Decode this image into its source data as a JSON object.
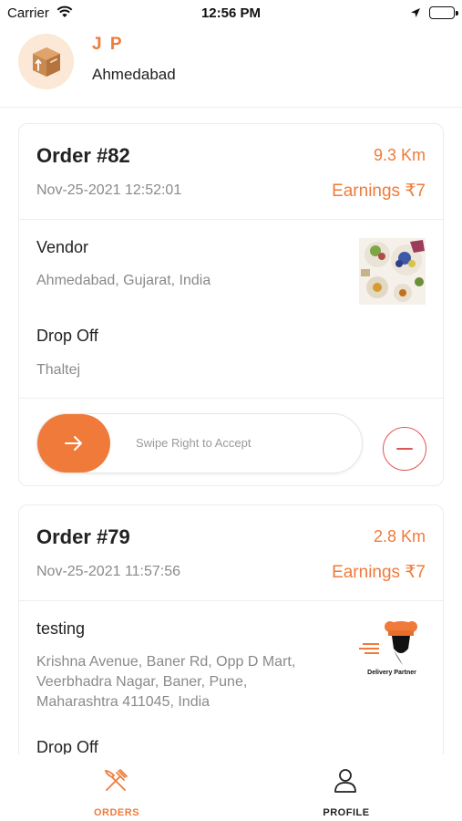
{
  "status_bar": {
    "carrier": "Carrier",
    "time": "12:56 PM",
    "wifi_icon": "wifi-icon",
    "location_icon": "location-arrow-icon",
    "battery_icon": "battery-full-icon"
  },
  "header": {
    "avatar_icon": "package-box-icon",
    "name": "J P",
    "city": "Ahmedabad"
  },
  "orders": [
    {
      "order_no": "Order #82",
      "distance": "9.3 Km",
      "datetime": "Nov-25-2021 12:52:01",
      "earnings": "Earnings ₹7",
      "vendor_title": "Vendor",
      "vendor_address": "Ahmedabad, Gujarat, India",
      "dropoff_title": "Drop Off",
      "dropoff_address": "Thaltej",
      "thumb": "food-platter-image",
      "swipe_label": "Swipe Right to Accept",
      "swipe_icon": "arrow-right-icon",
      "reject_icon": "minus-circle-icon"
    },
    {
      "order_no": "Order #79",
      "distance": "2.8 Km",
      "datetime": "Nov-25-2021 11:57:56",
      "earnings": "Earnings ₹7",
      "vendor_title": "testing",
      "vendor_address_lines": [
        "Krishna Avenue, Baner Rd, Opp D Mart,",
        "Veerbhadra Nagar, Baner, Pune,",
        "Maharashtra 411045, India"
      ],
      "dropoff_title": "Drop Off",
      "thumb": "delivery-partner-logo",
      "thumb_caption": "Delivery Partner"
    }
  ],
  "bottom_nav": {
    "tabs": [
      {
        "label": "ORDERS",
        "icon": "fork-knife-icon",
        "active": true
      },
      {
        "label": "PROFILE",
        "icon": "person-icon",
        "active": false
      }
    ]
  },
  "colors": {
    "accent": "#f07a3a",
    "reject": "#e05555",
    "muted_text": "#8a8a8a"
  }
}
